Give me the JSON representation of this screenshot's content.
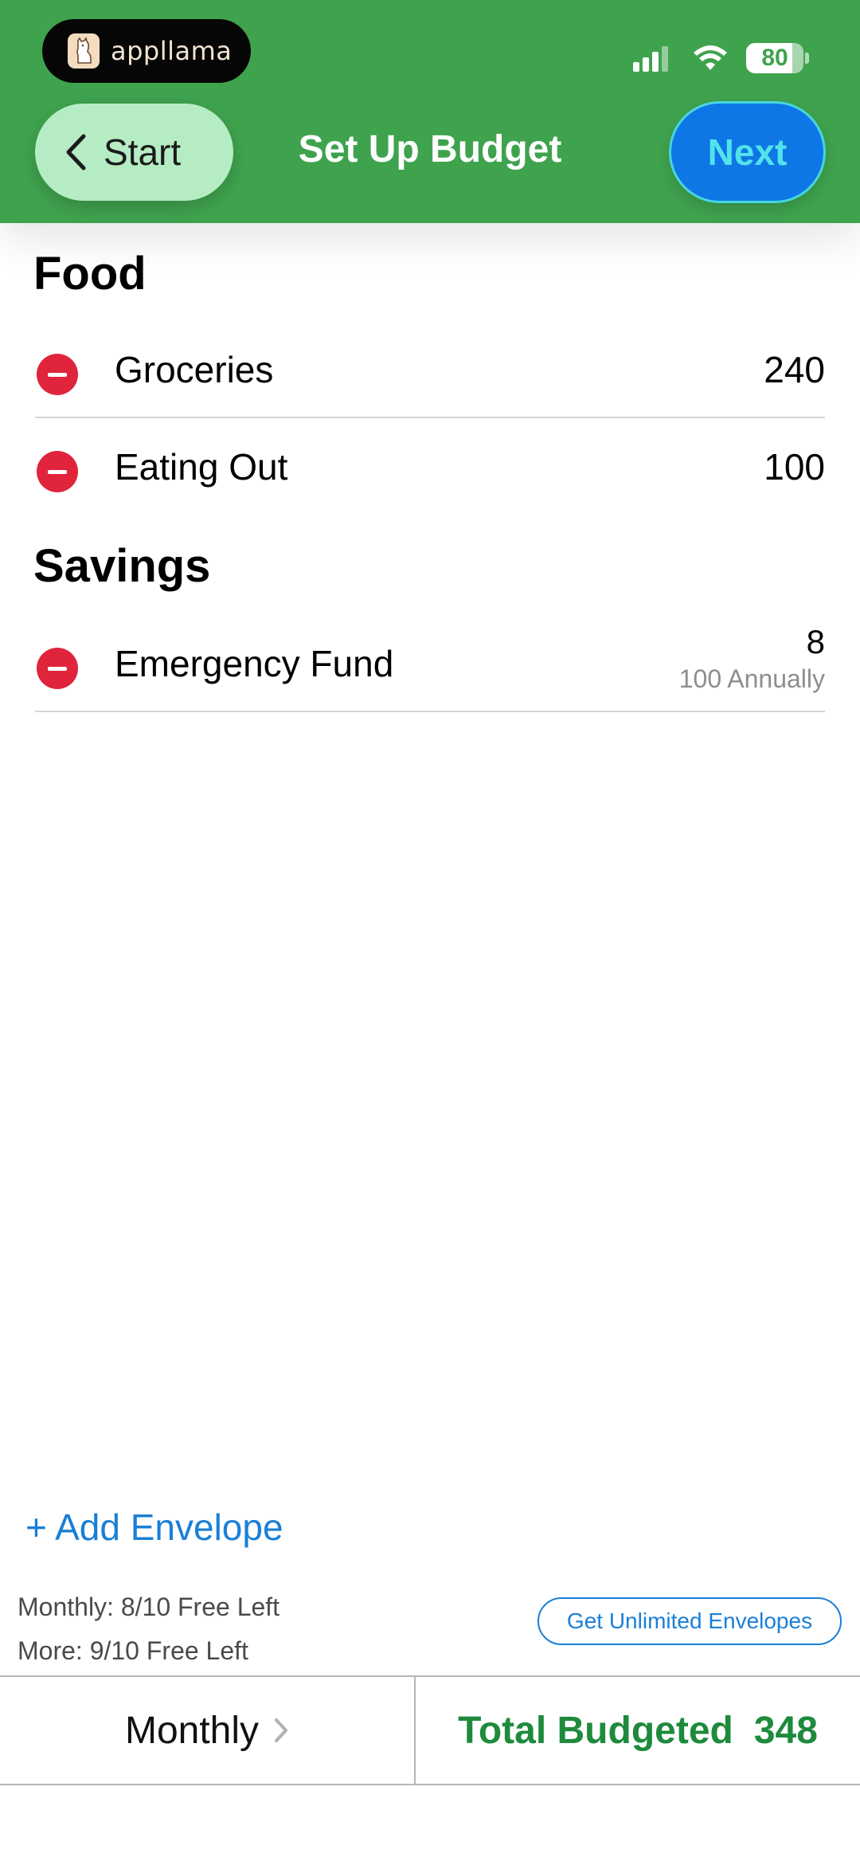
{
  "status_bar": {
    "app_pill_label": "appllama",
    "battery_level": "80",
    "battery_percent": 80
  },
  "header": {
    "back_label": "Start",
    "title": "Set Up Budget",
    "next_label": "Next",
    "colors": {
      "background": "#3fa34e",
      "next_button": "#0f76e6",
      "back_button": "#b6ecc4"
    }
  },
  "sections": [
    {
      "title": "Food",
      "items": [
        {
          "name": "Groceries",
          "amount": "240"
        },
        {
          "name": "Eating Out",
          "amount": "100"
        }
      ]
    },
    {
      "title": "Savings",
      "items": [
        {
          "name": "Emergency Fund",
          "amount": "8",
          "sub_amount": "100 Annually"
        }
      ]
    }
  ],
  "icons": {
    "remove": "minus-circle-icon",
    "back": "chevron-left-icon",
    "period": "chevron-right-icon"
  },
  "footer": {
    "add_envelope_label": "+ Add Envelope",
    "monthly_free_left": "Monthly: 8/10 Free Left",
    "more_free_left": "More: 9/10 Free Left",
    "unlimited_label": "Get Unlimited Envelopes",
    "period_label": "Monthly",
    "total_label": "Total Budgeted",
    "total_value": "348",
    "colors": {
      "link": "#1a7fd6",
      "total": "#1e8a3b"
    }
  }
}
